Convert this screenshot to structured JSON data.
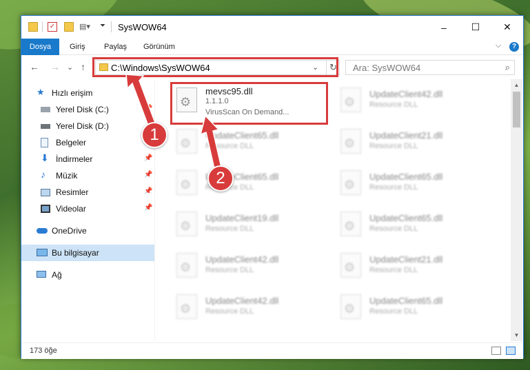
{
  "window": {
    "title": "SysWOW64",
    "minimize": "–",
    "maximize": "☐",
    "close": "✕"
  },
  "ribbon": {
    "tabs": [
      "Dosya",
      "Giriş",
      "Paylaş",
      "Görünüm"
    ],
    "help": "?",
    "collapse": "⌵"
  },
  "nav": {
    "back": "←",
    "forward": "→",
    "recent": "⌄",
    "up": "↑"
  },
  "address": {
    "path": "C:\\Windows\\SysWOW64",
    "dropdown": "⌄",
    "refresh": "↻"
  },
  "search": {
    "placeholder": "Ara: SysWOW64",
    "icon": "⌕"
  },
  "sidebar": {
    "items": [
      {
        "label": "Hızlı erişim",
        "icon": "star-icon",
        "pinned": false
      },
      {
        "label": "Yerel Disk (C:)",
        "icon": "drive-icon",
        "pinned": true
      },
      {
        "label": "Yerel Disk (D:)",
        "icon": "drive-icon",
        "pinned": false
      },
      {
        "label": "Belgeler",
        "icon": "document-icon",
        "pinned": true
      },
      {
        "label": "İndirmeler",
        "icon": "download-icon",
        "pinned": true
      },
      {
        "label": "Müzik",
        "icon": "music-icon",
        "pinned": true
      },
      {
        "label": "Resimler",
        "icon": "pictures-icon",
        "pinned": true
      },
      {
        "label": "Videolar",
        "icon": "video-icon",
        "pinned": true
      },
      {
        "label": "OneDrive",
        "icon": "cloud-icon",
        "pinned": false
      },
      {
        "label": "Bu bilgisayar",
        "icon": "computer-icon",
        "pinned": false
      },
      {
        "label": "Ağ",
        "icon": "network-icon",
        "pinned": false
      }
    ],
    "pin_glyph": "📌"
  },
  "files": {
    "left": [
      {
        "name": "mevsc95.dll",
        "line2": "1.1.1.0",
        "line3": "VirusScan On Demand..."
      },
      {
        "name": "UpdateClient65.dll",
        "line2": "Resource DLL"
      },
      {
        "name": "UpdateClient65.dll",
        "line2": "Resource DLL"
      },
      {
        "name": "UpdateClient19.dll",
        "line2": "Resource DLL"
      },
      {
        "name": "UpdateClient42.dll",
        "line2": "Resource DLL"
      },
      {
        "name": "UpdateClient42.dll",
        "line2": "Resource DLL"
      }
    ],
    "right": [
      {
        "name": "UpdateClient42.dll",
        "line2": "Resource DLL"
      },
      {
        "name": "UpdateClient21.dll",
        "line2": "Resource DLL"
      },
      {
        "name": "UpdateClient65.dll",
        "line2": "Resource DLL"
      },
      {
        "name": "UpdateClient65.dll",
        "line2": "Resource DLL"
      },
      {
        "name": "UpdateClient21.dll",
        "line2": "Resource DLL"
      },
      {
        "name": "UpdateClient65.dll",
        "line2": "Resource DLL"
      }
    ]
  },
  "status": {
    "count": "173 öğe"
  },
  "callouts": [
    "1",
    "2"
  ],
  "colors": {
    "accent": "#1979ca",
    "highlight": "#d83b3b",
    "selected": "#cde3f7"
  }
}
